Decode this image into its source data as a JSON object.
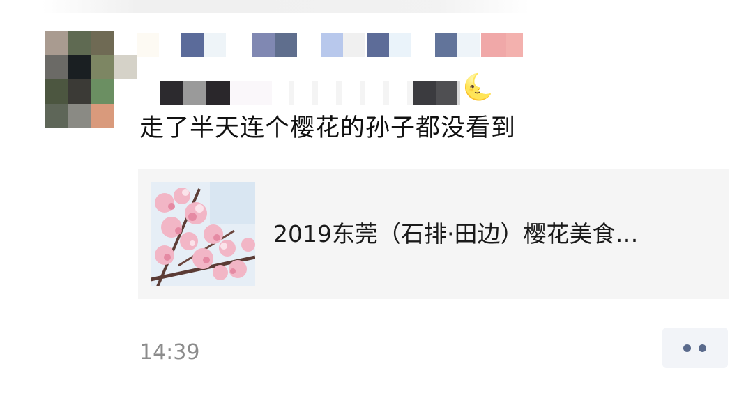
{
  "post": {
    "author_name_obscured": true,
    "line1_obscured": true,
    "line1_emoji": "🌜",
    "text": "走了半天连个樱花的孙子都没看到",
    "timestamp": "14:39"
  },
  "link_card": {
    "title": "2019东莞（石排·田边）樱花美食…",
    "thumbnail_icon": "cherry-blossom-photo"
  },
  "actions": {
    "more_icon": "two-dots-more-icon"
  },
  "colors": {
    "card_bg": "#f5f5f5",
    "timestamp": "#8c8c8c",
    "more_dots": "#5a6a8c"
  }
}
